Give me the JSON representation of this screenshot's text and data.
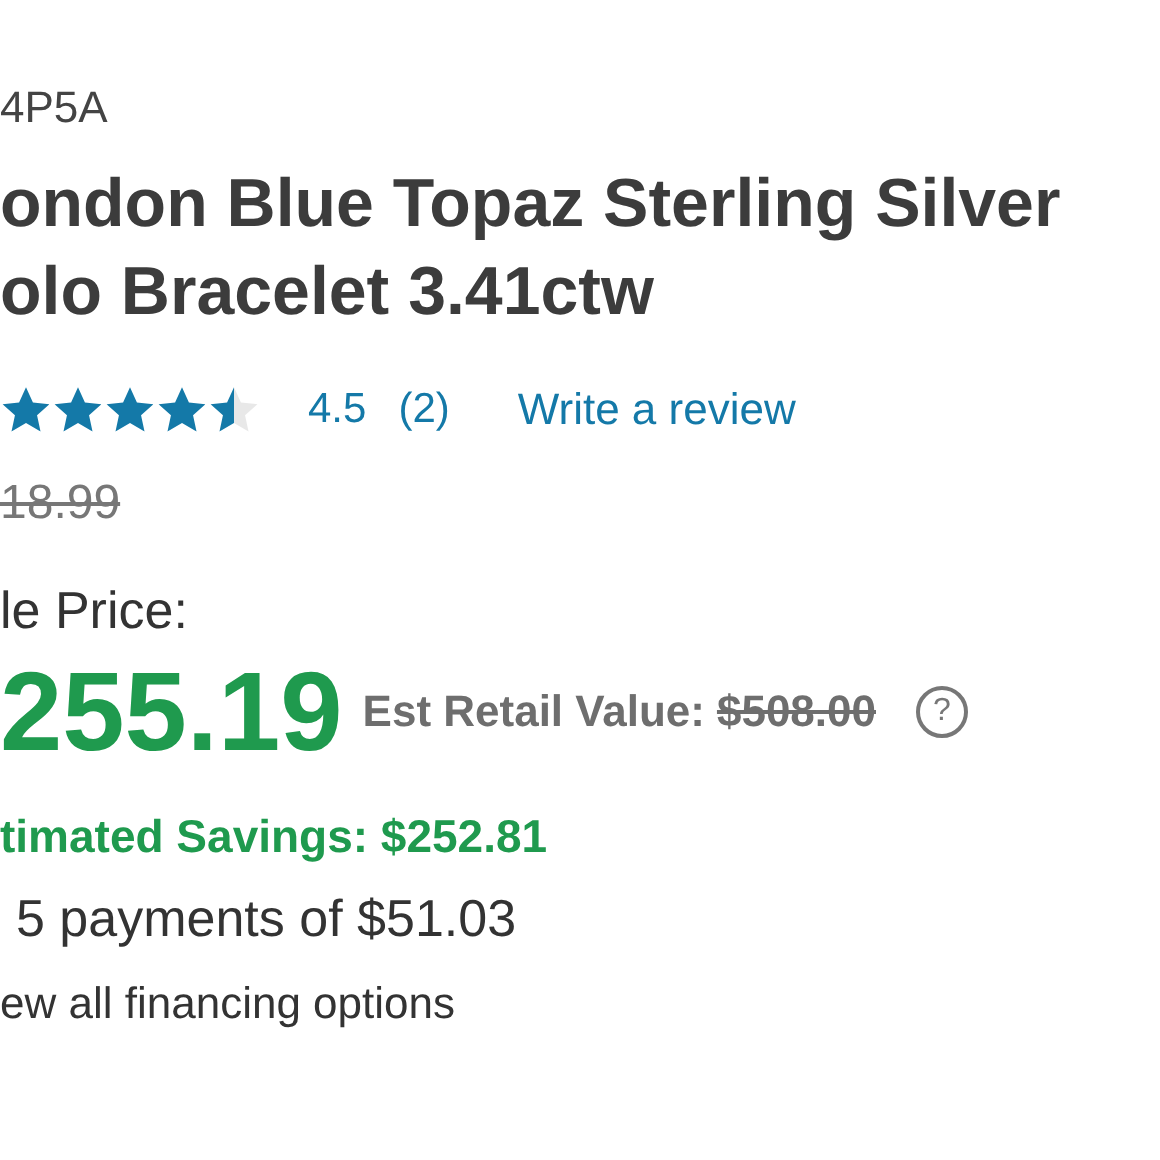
{
  "sku": "4P5A",
  "title_lines": [
    "ondon Blue Topaz Sterling Silver",
    "olo Bracelet 3.41ctw"
  ],
  "rating": {
    "stars": 4.5,
    "score": "4.5",
    "count": "(2)",
    "review_link": "Write a review"
  },
  "old_price": "18.99",
  "sale_label": "le Price:",
  "price": "255.19",
  "retail": {
    "label": "Est Retail Value:",
    "value": "$508.00",
    "help": "?"
  },
  "savings": "timated Savings: $252.81",
  "payments": "5 payments of $51.03",
  "financing_link": "ew all financing options"
}
